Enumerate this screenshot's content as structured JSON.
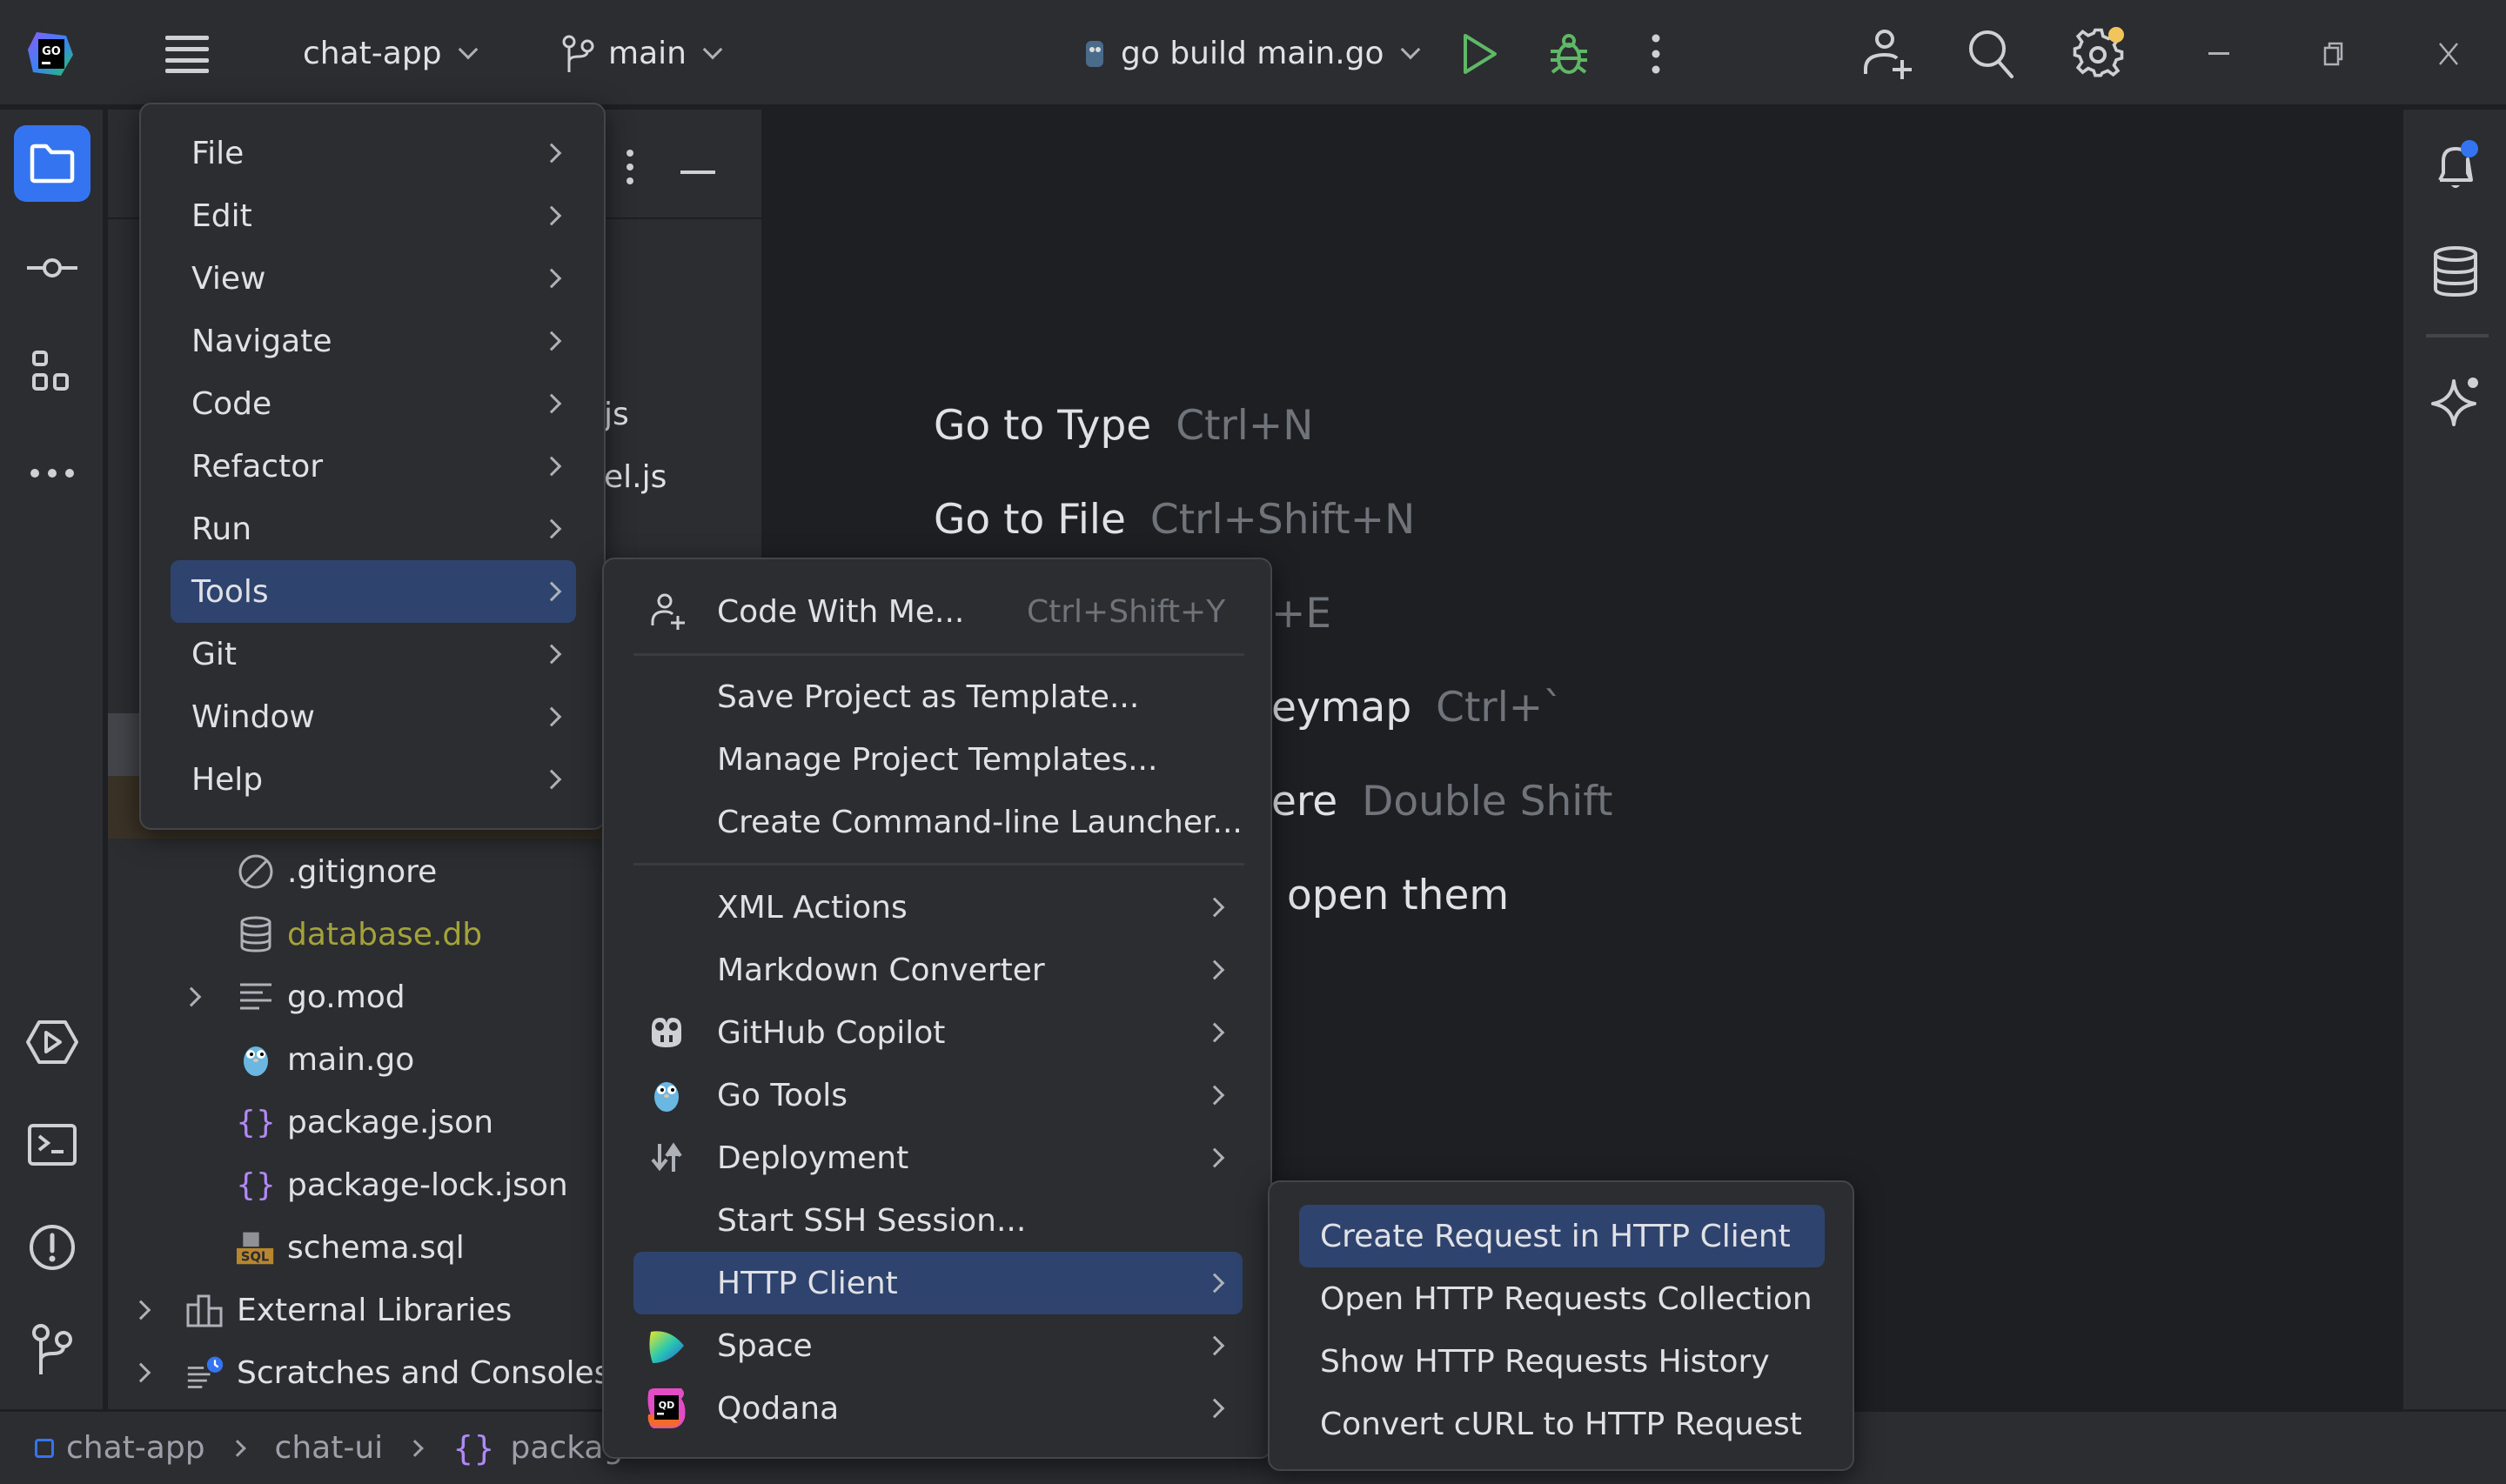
{
  "titlebar": {
    "project": "chat-app",
    "branch": "main",
    "run_config": "go build main.go"
  },
  "editor_hints": [
    {
      "label": "Go to Type",
      "shortcut": "Ctrl+N"
    },
    {
      "label": "Go to File",
      "shortcut": "Ctrl+Shift+N"
    },
    {
      "label": "",
      "shortcut": "+E"
    },
    {
      "label": "eymap",
      "shortcut": "Ctrl+`"
    },
    {
      "label": "ere",
      "shortcut": "Double Shift"
    },
    {
      "label": "open them",
      "shortcut": ""
    }
  ],
  "project_tree": {
    "partial_items": [
      "js",
      "el.js"
    ],
    "items": [
      {
        "name": ".gitignore",
        "icon": "ignore-icon",
        "color": "#dfe1e5"
      },
      {
        "name": "database.db",
        "icon": "database-icon",
        "color": "#a3a33a"
      },
      {
        "name": "go.mod",
        "icon": "text-file-icon",
        "color": "#dfe1e5",
        "expandable": true
      },
      {
        "name": "main.go",
        "icon": "gopher-icon",
        "color": "#dfe1e5"
      },
      {
        "name": "package.json",
        "icon": "json-icon",
        "color": "#dfe1e5"
      },
      {
        "name": "package-lock.json",
        "icon": "json-icon",
        "color": "#dfe1e5",
        "selected": true
      },
      {
        "name": "schema.sql",
        "icon": "sql-icon",
        "color": "#dfe1e5"
      },
      {
        "name": "External Libraries",
        "icon": "library-icon",
        "color": "#dfe1e5",
        "expandable": true
      },
      {
        "name": "Scratches and Consoles",
        "icon": "scratches-icon",
        "color": "#dfe1e5",
        "expandable": true
      }
    ]
  },
  "main_menu": [
    {
      "label": "File"
    },
    {
      "label": "Edit"
    },
    {
      "label": "View"
    },
    {
      "label": "Navigate"
    },
    {
      "label": "Code"
    },
    {
      "label": "Refactor"
    },
    {
      "label": "Run"
    },
    {
      "label": "Tools",
      "highlighted": true
    },
    {
      "label": "Git"
    },
    {
      "label": "Window"
    },
    {
      "label": "Help"
    }
  ],
  "tools_menu": {
    "code_with_me": {
      "label": "Code With Me...",
      "shortcut": "Ctrl+Shift+Y"
    },
    "templates": [
      {
        "label": "Save Project as Template..."
      },
      {
        "label": "Manage Project Templates..."
      },
      {
        "label": "Create Command-line Launcher..."
      }
    ],
    "items": [
      {
        "label": "XML Actions",
        "submenu": true
      },
      {
        "label": "Markdown Converter",
        "submenu": true
      },
      {
        "label": "GitHub Copilot",
        "submenu": true,
        "icon": "copilot-icon"
      },
      {
        "label": "Go Tools",
        "submenu": true,
        "icon": "gopher-icon"
      },
      {
        "label": "Deployment",
        "submenu": true,
        "icon": "deployment-icon"
      },
      {
        "label": "Start SSH Session...",
        "submenu": false
      },
      {
        "label": "HTTP Client",
        "submenu": true,
        "highlighted": true
      },
      {
        "label": "Space",
        "submenu": true,
        "icon": "space-icon"
      },
      {
        "label": "Qodana",
        "submenu": true,
        "icon": "qodana-icon"
      }
    ]
  },
  "http_client_menu": [
    {
      "label": "Create Request in HTTP Client",
      "highlighted": true
    },
    {
      "label": "Open HTTP Requests Collection"
    },
    {
      "label": "Show HTTP Requests History"
    },
    {
      "label": "Convert cURL to HTTP Request"
    }
  ],
  "breadcrumbs": [
    "chat-app",
    "chat-ui",
    "package"
  ],
  "colors": {
    "accent": "#3574f0",
    "highlight": "#2e436e",
    "run_green": "#5fb865",
    "settings_badge": "#f2c55c"
  }
}
